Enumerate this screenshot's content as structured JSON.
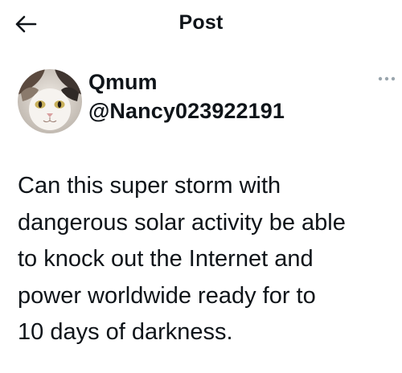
{
  "header": {
    "back_icon": "back-arrow-icon",
    "title": "Post"
  },
  "author": {
    "avatar_icon": "cat-avatar",
    "display_name": "Qmum",
    "handle": "@Nancy023922191",
    "more_icon": "more-horizontal-icon"
  },
  "tweet": {
    "text": "Can this super storm with\ndangerous solar activity be able\nto knock out the Internet and\npower worldwide ready for to\n10 days of darkness."
  },
  "colors": {
    "text": "#0f1419",
    "muted": "#9aa5ad",
    "background": "#ffffff"
  }
}
